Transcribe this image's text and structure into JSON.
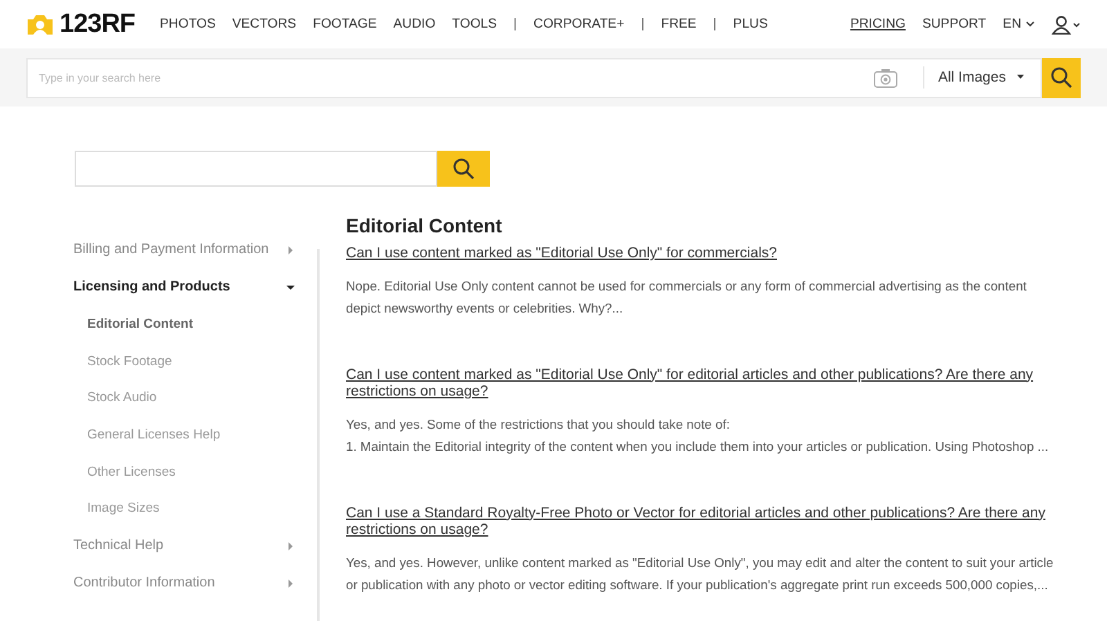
{
  "header": {
    "logo": "123RF",
    "nav": [
      {
        "kind": "link",
        "label": "PHOTOS"
      },
      {
        "kind": "link",
        "label": "VECTORS"
      },
      {
        "kind": "link",
        "label": "FOOTAGE"
      },
      {
        "kind": "link",
        "label": "AUDIO"
      },
      {
        "kind": "link",
        "label": "TOOLS"
      },
      {
        "kind": "separator",
        "label": "|"
      },
      {
        "kind": "link",
        "label": "CORPORATE+"
      },
      {
        "kind": "separator",
        "label": "|"
      },
      {
        "kind": "link",
        "label": "FREE"
      },
      {
        "kind": "separator",
        "label": "|"
      },
      {
        "kind": "link",
        "label": "PLUS"
      }
    ],
    "right": [
      {
        "kind": "underlined",
        "label": "PRICING"
      },
      {
        "kind": "link",
        "label": "SUPPORT"
      },
      {
        "kind": "dropdown",
        "label": "EN"
      }
    ]
  },
  "search": {
    "placeholder": "Type in your search here",
    "filter": "All Images"
  },
  "sidebar": [
    {
      "label": "Billing and Payment Information",
      "expanded": false
    },
    {
      "label": "Licensing and Products",
      "expanded": true,
      "children": [
        {
          "label": "Editorial Content",
          "selected": true
        },
        {
          "label": "Stock Footage",
          "selected": false
        },
        {
          "label": "Stock Audio",
          "selected": false
        },
        {
          "label": "General Licenses Help",
          "selected": false
        },
        {
          "label": "Other Licenses",
          "selected": false
        },
        {
          "label": "Image Sizes",
          "selected": false
        }
      ]
    },
    {
      "label": "Technical Help",
      "expanded": false
    },
    {
      "label": "Contributor Information",
      "expanded": false
    }
  ],
  "content": {
    "title": "Editorial Content",
    "faqs": [
      {
        "question": "Can I use content marked as \"Editorial Use Only\" for commercials?",
        "lines": [
          "Nope. Editorial Use Only content cannot be used for commercials or any form of commercial advertising as the content",
          "depict newsworthy events or celebrities. Why?..."
        ]
      },
      {
        "question": "Can I use content marked as \"Editorial Use Only\" for editorial articles and other publications? Are there any restrictions on usage?",
        "lines": [
          "Yes, and yes. Some of the restrictions that you should take note of:",
          "1. Maintain the Editorial integrity of the content when you include them into your articles or publication. Using Photoshop ..."
        ]
      },
      {
        "question": "Can I use a Standard Royalty-Free Photo or Vector for editorial articles and other publications? Are there any restrictions on usage?",
        "lines": [
          "Yes, and yes. However, unlike content marked as \"Editorial Use Only\", you may edit and alter the content to suit your article",
          "or publication with any photo or vector editing software. If your publication's aggregate print run exceeds 500,000 copies,..."
        ]
      }
    ]
  }
}
